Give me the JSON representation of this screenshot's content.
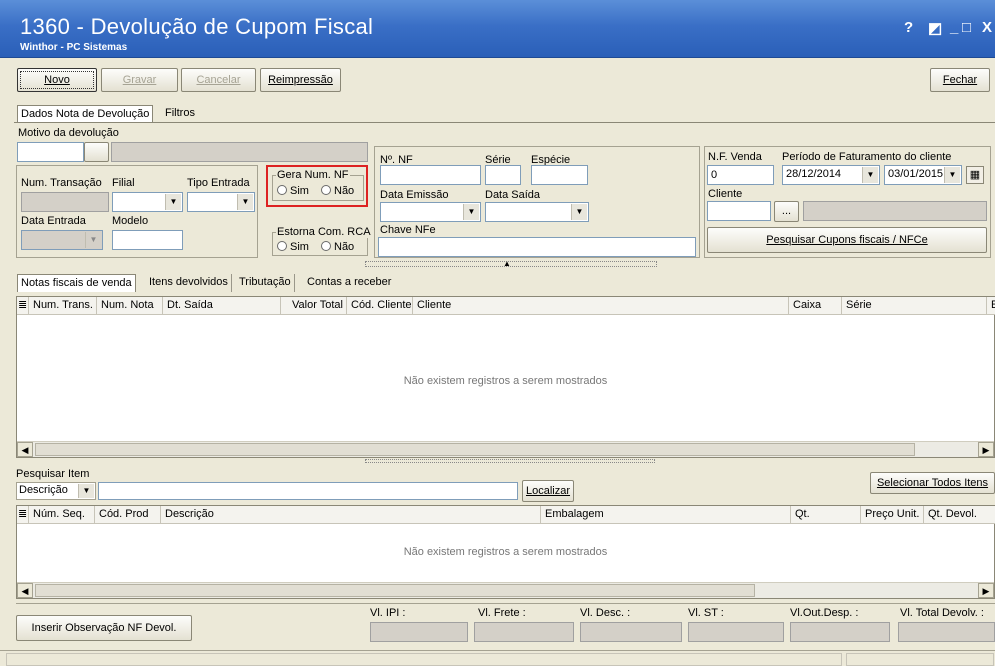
{
  "window": {
    "title": "1360 - Devolução de Cupom Fiscal",
    "subtitle": "Winthor - PC Sistemas",
    "controls": [
      "?",
      "◩",
      "_",
      "□",
      "X"
    ]
  },
  "toolbar": {
    "novo": "Novo",
    "gravar": "Gravar",
    "cancelar": "Cancelar",
    "reimpressao": "Reimpressão",
    "fechar": "Fechar"
  },
  "top_tabs": [
    "Dados Nota de Devolução",
    "Filtros"
  ],
  "form": {
    "motivo_label": "Motivo da devolução",
    "num_transacao_label": "Num. Transação",
    "filial_label": "Filial",
    "tipo_entrada_label": "Tipo Entrada",
    "data_entrada_label": "Data Entrada",
    "modelo_label": "Modelo",
    "gera_num_nf_label": "Gera Num. NF",
    "estorna_rca_label": "Estorna Com. RCA",
    "sim": "Sim",
    "nao": "Não",
    "nf_label": "Nº. NF",
    "serie_label": "Série",
    "especie_label": "Espécie",
    "data_emissao_label": "Data Emissão",
    "data_saida_label": "Data Saída",
    "chave_nfe_label": "Chave NFe",
    "nf_venda_label": "N.F. Venda",
    "nf_venda_value": "0",
    "periodo_label": "Período de Faturamento do cliente",
    "periodo_inicio": "28/12/2014",
    "periodo_fim": "03/01/2015",
    "cliente_label": "Cliente",
    "cliente_button": "...",
    "pesquisar_button": "Pesquisar Cupons fiscais / NFCe"
  },
  "sub_tabs": [
    "Notas fiscais de venda",
    "Itens devolvidos",
    "Tributação",
    "Contas a receber"
  ],
  "grid1": {
    "columns": [
      "Num. Trans.",
      "Num. Nota",
      "Dt. Saída",
      "Valor Total",
      "Cód. Cliente",
      "Cliente",
      "Caixa",
      "Série",
      "E"
    ],
    "empty_text": "Não existem registros a serem mostrados"
  },
  "item_search": {
    "label": "Pesquisar Item",
    "field_option": "Descrição",
    "localizar": "Localizar",
    "selecionar_todos": "Selecionar Todos Itens"
  },
  "grid2": {
    "columns": [
      "Núm. Seq.",
      "Cód. Prod",
      "Descrição",
      "Embalagem",
      "Qt.",
      "Preço Unit.",
      "Qt. Devol."
    ],
    "empty_text": "Não existem registros a serem mostrados"
  },
  "footer": {
    "inserir_obs": "Inserir Observação NF Devol.",
    "vl_ipi": "Vl. IPI :",
    "vl_frete": "Vl. Frete :",
    "vl_desc": "Vl. Desc. :",
    "vl_st": "Vl. ST :",
    "vl_out_desp": "Vl.Out.Desp. :",
    "vl_total_devolv": "Vl. Total Devolv. :"
  }
}
